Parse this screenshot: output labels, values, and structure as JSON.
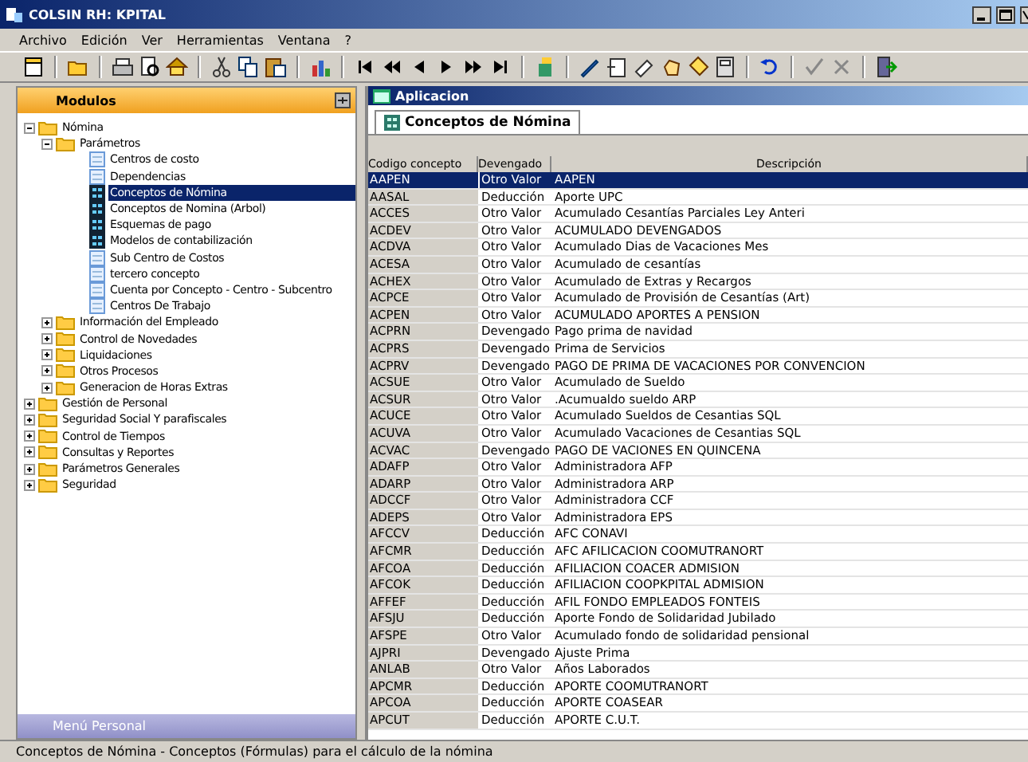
{
  "window": {
    "title": "COLSIN RH: KPITAL"
  },
  "menu": [
    "Archivo",
    "Edición",
    "Ver",
    "Herramientas",
    "Ventana",
    "?"
  ],
  "left_panel": {
    "title": "Modulos",
    "footer": "Menú Personal"
  },
  "tree": [
    {
      "label": "Nómina",
      "kind": "folder",
      "expanded": true,
      "selected": false,
      "children": [
        {
          "label": "Parámetros",
          "kind": "folder",
          "expanded": true,
          "selected": false,
          "children": [
            {
              "label": "Centros de costo",
              "kind": "list",
              "selected": false
            },
            {
              "label": "Dependencias",
              "kind": "list",
              "selected": false
            },
            {
              "label": "Conceptos de Nómina",
              "kind": "grid",
              "selected": true
            },
            {
              "label": "Conceptos de Nomina (Arbol)",
              "kind": "grid",
              "selected": false
            },
            {
              "label": "Esquemas de pago",
              "kind": "grid",
              "selected": false
            },
            {
              "label": "Modelos de contabilización",
              "kind": "grid",
              "selected": false
            },
            {
              "label": "Sub Centro de Costos",
              "kind": "list",
              "selected": false
            },
            {
              "label": "tercero concepto",
              "kind": "list",
              "selected": false
            },
            {
              "label": "Cuenta por Concepto - Centro - Subcentro",
              "kind": "list",
              "selected": false
            },
            {
              "label": "Centros De Trabajo",
              "kind": "list",
              "selected": false
            }
          ]
        },
        {
          "label": "Información del Empleado",
          "kind": "folder",
          "expanded": false,
          "selected": false
        },
        {
          "label": "Control de Novedades",
          "kind": "folder",
          "expanded": false,
          "selected": false
        },
        {
          "label": "Liquidaciones",
          "kind": "folder",
          "expanded": false,
          "selected": false
        },
        {
          "label": "Otros Procesos",
          "kind": "folder",
          "expanded": false,
          "selected": false
        },
        {
          "label": "Generacion de Horas Extras",
          "kind": "folder",
          "expanded": false,
          "selected": false
        }
      ]
    },
    {
      "label": "Gestión de Personal",
      "kind": "folder",
      "expanded": false,
      "selected": false
    },
    {
      "label": "Seguridad Social Y parafiscales",
      "kind": "folder",
      "expanded": false,
      "selected": false
    },
    {
      "label": "Control de Tiempos",
      "kind": "folder",
      "expanded": false,
      "selected": false
    },
    {
      "label": "Consultas y Reportes",
      "kind": "folder",
      "expanded": false,
      "selected": false
    },
    {
      "label": "Parámetros Generales",
      "kind": "folder",
      "expanded": false,
      "selected": false
    },
    {
      "label": "Seguridad",
      "kind": "folder",
      "expanded": false,
      "selected": false
    }
  ],
  "app_window": {
    "title": "Aplicacion"
  },
  "tabs": [
    {
      "label": "Conceptos de Nómina",
      "selected": true
    }
  ],
  "table": {
    "columns": [
      "Codigo concepto",
      "Devengado",
      "Descripción"
    ],
    "rows": [
      {
        "cells": [
          "AAPEN",
          "Otro Valor",
          "AAPEN"
        ],
        "selected": true
      },
      {
        "cells": [
          "AASAL",
          "Deducción",
          "Aporte UPC"
        ],
        "selected": false
      },
      {
        "cells": [
          "ACCES",
          "Otro Valor",
          "Acumulado Cesantías Parciales Ley Anteri"
        ],
        "selected": false
      },
      {
        "cells": [
          "ACDEV",
          "Otro Valor",
          "ACUMULADO DEVENGADOS"
        ],
        "selected": false
      },
      {
        "cells": [
          "ACDVA",
          "Otro Valor",
          "Acumulado Dias de Vacaciones Mes"
        ],
        "selected": false
      },
      {
        "cells": [
          "ACESA",
          "Otro Valor",
          "Acumulado de cesantías"
        ],
        "selected": false
      },
      {
        "cells": [
          "ACHEX",
          "Otro Valor",
          "Acumulado de Extras y Recargos"
        ],
        "selected": false
      },
      {
        "cells": [
          "ACPCE",
          "Otro Valor",
          "Acumulado de Provisión de Cesantías (Art)"
        ],
        "selected": false
      },
      {
        "cells": [
          "ACPEN",
          "Otro Valor",
          "ACUMULADO APORTES A PENSION"
        ],
        "selected": false
      },
      {
        "cells": [
          "ACPRN",
          "Devengado",
          "Pago prima de navidad"
        ],
        "selected": false
      },
      {
        "cells": [
          "ACPRS",
          "Devengado",
          "Prima de Servicios"
        ],
        "selected": false
      },
      {
        "cells": [
          "ACPRV",
          "Devengado",
          "PAGO DE PRIMA DE VACACIONES POR CONVENCION"
        ],
        "selected": false
      },
      {
        "cells": [
          "ACSUE",
          "Otro Valor",
          "Acumulado de Sueldo"
        ],
        "selected": false
      },
      {
        "cells": [
          "ACSUR",
          "Otro Valor",
          ".Acumualdo sueldo ARP"
        ],
        "selected": false
      },
      {
        "cells": [
          "ACUCE",
          "Otro Valor",
          "Acumulado Sueldos de Cesantias SQL"
        ],
        "selected": false
      },
      {
        "cells": [
          "ACUVA",
          "Otro Valor",
          "Acumulado Vacaciones de Cesantias SQL"
        ],
        "selected": false
      },
      {
        "cells": [
          "ACVAC",
          "Devengado",
          "PAGO DE VACIONES EN QUINCENA"
        ],
        "selected": false
      },
      {
        "cells": [
          "ADAFP",
          "Otro Valor",
          "Administradora AFP"
        ],
        "selected": false
      },
      {
        "cells": [
          "ADARP",
          "Otro Valor",
          "Administradora ARP"
        ],
        "selected": false
      },
      {
        "cells": [
          "ADCCF",
          "Otro Valor",
          "Administradora CCF"
        ],
        "selected": false
      },
      {
        "cells": [
          "ADEPS",
          "Otro Valor",
          "Administradora EPS"
        ],
        "selected": false
      },
      {
        "cells": [
          "AFCCV",
          "Deducción",
          "AFC CONAVI"
        ],
        "selected": false
      },
      {
        "cells": [
          "AFCMR",
          "Deducción",
          "AFC AFILICACION COOMUTRANORT"
        ],
        "selected": false
      },
      {
        "cells": [
          "AFCOA",
          "Deducción",
          "AFILIACION COACER ADMISION"
        ],
        "selected": false
      },
      {
        "cells": [
          "AFCOK",
          "Deducción",
          "AFILIACION COOPKPITAL ADMISION"
        ],
        "selected": false
      },
      {
        "cells": [
          "AFFEF",
          "Deducción",
          "AFIL FONDO EMPLEADOS FONTEIS"
        ],
        "selected": false
      },
      {
        "cells": [
          "AFSJU",
          "Deducción",
          "Aporte Fondo de Solidaridad Jubilado"
        ],
        "selected": false
      },
      {
        "cells": [
          "AFSPE",
          "Otro Valor",
          "Acumulado fondo de solidaridad pensional"
        ],
        "selected": false
      },
      {
        "cells": [
          "AJPRI",
          "Devengado",
          "Ajuste Prima"
        ],
        "selected": false
      },
      {
        "cells": [
          "ANLAB",
          "Otro Valor",
          "Años Laborados"
        ],
        "selected": false
      },
      {
        "cells": [
          "APCMR",
          "Deducción",
          "APORTE COOMUTRANORT"
        ],
        "selected": false
      },
      {
        "cells": [
          "APCOA",
          "Deducción",
          "APORTE COASEAR"
        ],
        "selected": false
      },
      {
        "cells": [
          "APCUT",
          "Deducción",
          "APORTE C.U.T."
        ],
        "selected": false
      }
    ]
  },
  "status_bar": "Conceptos de Nómina - Conceptos (Fórmulas) para el cálculo de la nómina"
}
